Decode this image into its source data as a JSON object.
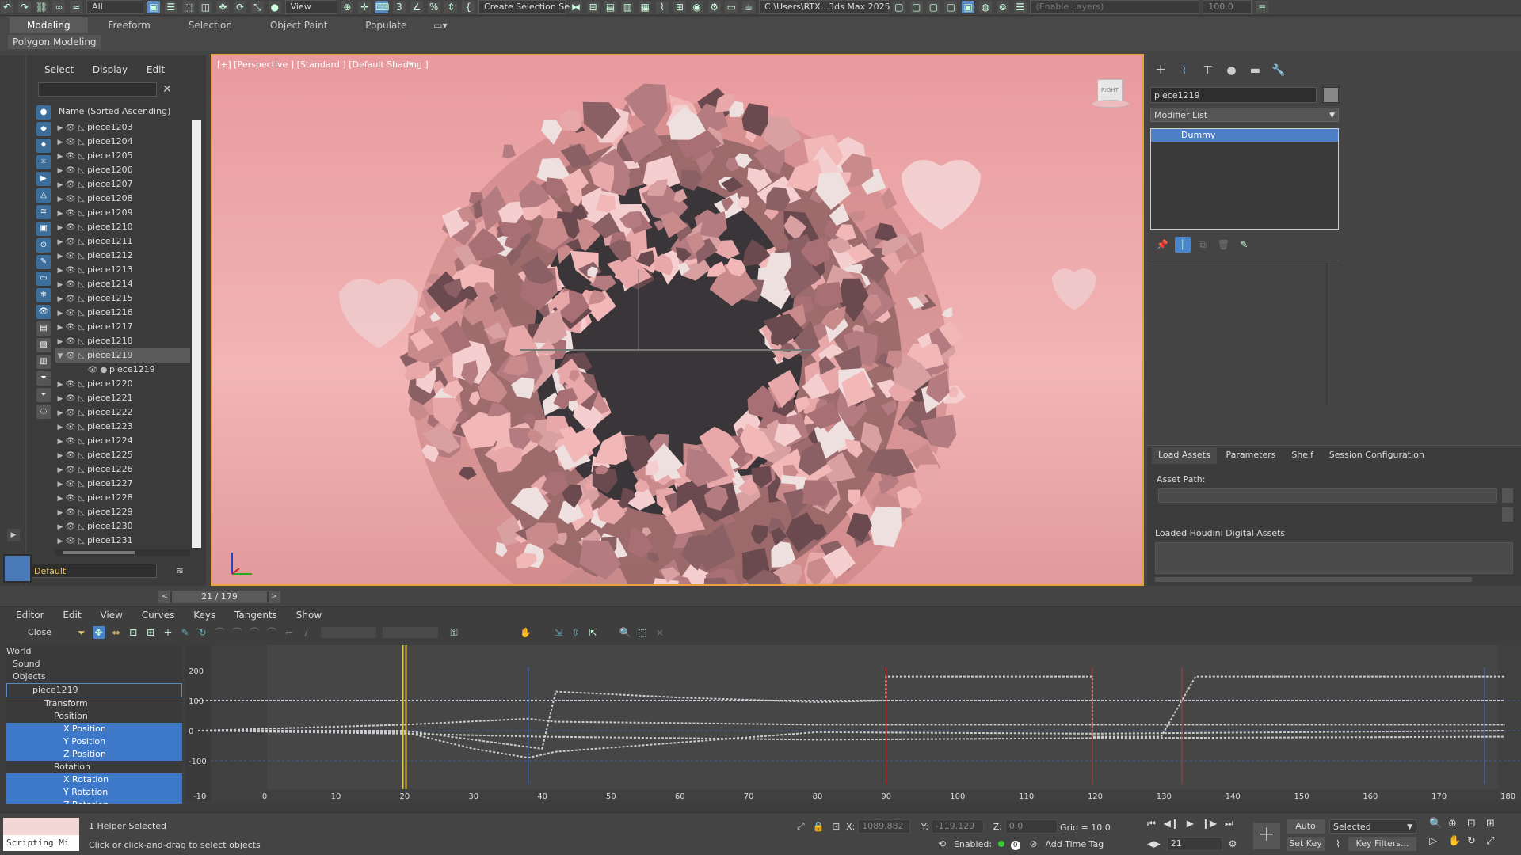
{
  "toolbar": {
    "selection_filter": "All",
    "ref_coord": "View",
    "named_selection": "Create Selection Se",
    "project_path": "C:\\Users\\RTX...3ds Max 2025",
    "layer_field": "(Enable Layers)",
    "percent_value": "100.0"
  },
  "ribbon": {
    "tabs": [
      "Modeling",
      "Freeform",
      "Selection",
      "Object Paint",
      "Populate"
    ],
    "sub_label": "Polygon Modeling"
  },
  "scene_explorer": {
    "menu": [
      "Select",
      "Display",
      "Edit"
    ],
    "column_header": "Name (Sorted Ascending)",
    "items": [
      {
        "name": "piece1203",
        "expanded": false,
        "selected": false,
        "child": false
      },
      {
        "name": "piece1204",
        "expanded": false,
        "selected": false,
        "child": false
      },
      {
        "name": "piece1205",
        "expanded": false,
        "selected": false,
        "child": false
      },
      {
        "name": "piece1206",
        "expanded": false,
        "selected": false,
        "child": false
      },
      {
        "name": "piece1207",
        "expanded": false,
        "selected": false,
        "child": false
      },
      {
        "name": "piece1208",
        "expanded": false,
        "selected": false,
        "child": false
      },
      {
        "name": "piece1209",
        "expanded": false,
        "selected": false,
        "child": false
      },
      {
        "name": "piece1210",
        "expanded": false,
        "selected": false,
        "child": false
      },
      {
        "name": "piece1211",
        "expanded": false,
        "selected": false,
        "child": false
      },
      {
        "name": "piece1212",
        "expanded": false,
        "selected": false,
        "child": false
      },
      {
        "name": "piece1213",
        "expanded": false,
        "selected": false,
        "child": false
      },
      {
        "name": "piece1214",
        "expanded": false,
        "selected": false,
        "child": false
      },
      {
        "name": "piece1215",
        "expanded": false,
        "selected": false,
        "child": false
      },
      {
        "name": "piece1216",
        "expanded": false,
        "selected": false,
        "child": false
      },
      {
        "name": "piece1217",
        "expanded": false,
        "selected": false,
        "child": false
      },
      {
        "name": "piece1218",
        "expanded": false,
        "selected": false,
        "child": false
      },
      {
        "name": "piece1219",
        "expanded": true,
        "selected": true,
        "child": false
      },
      {
        "name": "piece1219",
        "expanded": false,
        "selected": false,
        "child": true
      },
      {
        "name": "piece1220",
        "expanded": false,
        "selected": false,
        "child": false
      },
      {
        "name": "piece1221",
        "expanded": false,
        "selected": false,
        "child": false
      },
      {
        "name": "piece1222",
        "expanded": false,
        "selected": false,
        "child": false
      },
      {
        "name": "piece1223",
        "expanded": false,
        "selected": false,
        "child": false
      },
      {
        "name": "piece1224",
        "expanded": false,
        "selected": false,
        "child": false
      },
      {
        "name": "piece1225",
        "expanded": false,
        "selected": false,
        "child": false
      },
      {
        "name": "piece1226",
        "expanded": false,
        "selected": false,
        "child": false
      },
      {
        "name": "piece1227",
        "expanded": false,
        "selected": false,
        "child": false
      },
      {
        "name": "piece1228",
        "expanded": false,
        "selected": false,
        "child": false
      },
      {
        "name": "piece1229",
        "expanded": false,
        "selected": false,
        "child": false
      },
      {
        "name": "piece1230",
        "expanded": false,
        "selected": false,
        "child": false
      },
      {
        "name": "piece1231",
        "expanded": false,
        "selected": false,
        "child": false
      }
    ],
    "layer_dropdown": "Default"
  },
  "viewport": {
    "label": "[+] [Perspective ] [Standard ] [Default Shading ]",
    "viewcube_label": "RIGHT",
    "background": "#e8a0a0"
  },
  "command_panel": {
    "object_name": "piece1219",
    "modifier_list": "Modifier List",
    "stack_item": "Dummy",
    "houdini_tabs": [
      "Load Assets",
      "Parameters",
      "Shelf",
      "Session Configuration"
    ],
    "asset_path_label": "Asset Path:",
    "loaded_label": "Loaded Houdini Digital Assets"
  },
  "time_slider": {
    "label": "21 / 179"
  },
  "curve_editor": {
    "menu": [
      "Editor",
      "Edit",
      "View",
      "Curves",
      "Keys",
      "Tangents",
      "Show"
    ],
    "close_label": "Close",
    "tree": [
      {
        "label": "World",
        "hl": false
      },
      {
        "label": "Sound",
        "hl": false
      },
      {
        "label": "Objects",
        "hl": false
      },
      {
        "label": "piece1219",
        "hl": false
      },
      {
        "label": "Transform",
        "hl": false
      },
      {
        "label": "Position",
        "hl": false
      },
      {
        "label": "X Position",
        "hl": true
      },
      {
        "label": "Y Position",
        "hl": true
      },
      {
        "label": "Z Position",
        "hl": true
      },
      {
        "label": "Rotation",
        "hl": false
      },
      {
        "label": "X Rotation",
        "hl": true
      },
      {
        "label": "Y Rotation",
        "hl": true
      },
      {
        "label": "Z Rotation",
        "hl": true
      }
    ],
    "y_ticks": [
      "200",
      "100",
      "0",
      "-100"
    ],
    "x_ticks": [
      "-10",
      "0",
      "10",
      "20",
      "30",
      "40",
      "50",
      "60",
      "70",
      "80",
      "90",
      "100",
      "110",
      "120",
      "130",
      "140",
      "150",
      "160",
      "170",
      "180"
    ]
  },
  "status": {
    "script_label": "Scripting Mi",
    "selected_text": "1 Helper Selected",
    "hint_text": "Click or click-and-drag to select objects",
    "x_label": "X:",
    "x_value": "1089.882",
    "y_label": "Y:",
    "y_value": "-119.129",
    "z_label": "Z:",
    "z_value": "0.0",
    "grid": "Grid = 10.0",
    "enabled_label": "Enabled:",
    "enabled_value": "0",
    "add_time_tag": "Add Time Tag",
    "auto_key": "Auto Key",
    "set_key": "Set Key",
    "selected_dd": "Selected",
    "key_filters": "Key Filters...",
    "frame": "21"
  }
}
